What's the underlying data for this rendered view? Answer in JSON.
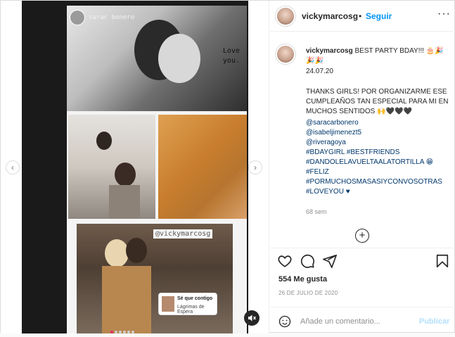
{
  "post": {
    "username": "vickymarcosg",
    "follow_separator": "•",
    "follow_label": "Seguir",
    "more_label": "···"
  },
  "story": {
    "username": "sarac bonero",
    "love_text_1": "Love",
    "love_text_2": "you.",
    "handle_tag": "@vickymarcosg",
    "music_line_1": "Sé que contigo",
    "music_line_2": "Lágrimas de Espera"
  },
  "caption": {
    "username": "vickymarcosg",
    "text": "BEST PARTY BDAY!!!",
    "emoji_1": "🎂🎉",
    "emoji_2": "🎉🎉",
    "date": "24.07.20",
    "body": "THANKS GIRLS! POR ORGANIZARME ESE CUMPLEAÑOS TAN ESPECIAL PARA MI EN MUCHOS SENTIDOS 🙌🖤🖤🖤",
    "links": [
      "@saracarbonero",
      "@isabeljimenezt5",
      "@riveragoya",
      "#BDAYGIRL #BESTFRIENDS",
      "#DANDOLELAVUELTAALATORTILLA 😁",
      "#FELIZ",
      "#PORMUCHOSMASASIYCONVOSOTRAS",
      "#LOVEYOU ♥"
    ],
    "time_ago": "68 sem",
    "load_more": "+"
  },
  "stats": {
    "likes": "554 Me gusta",
    "date": "26 DE JULIO DE 2020"
  },
  "comment_box": {
    "placeholder": "Añade un comentario...",
    "publish_label": "Publicar"
  },
  "nav": {
    "prev": "‹",
    "next": "›"
  },
  "colors": {
    "accent": "#0095f6",
    "link": "#00376b",
    "muted": "#8e8e8e",
    "publish_disabled": "#b2dffc"
  },
  "icons": [
    "heart-icon",
    "comment-icon",
    "share-icon",
    "bookmark-icon",
    "smile-icon",
    "plus-circle-icon",
    "mute-icon",
    "chevron-left-icon",
    "chevron-right-icon",
    "more-icon"
  ]
}
